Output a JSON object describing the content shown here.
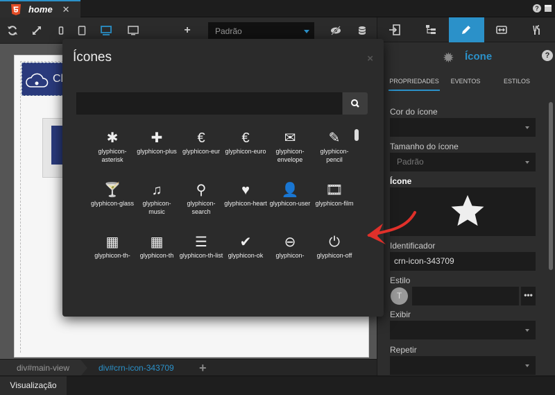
{
  "tabbar": {
    "tab_title": "home",
    "tab_close": "✕",
    "help": "?"
  },
  "toolbar": {
    "mode_select_value": "Padrão",
    "add_label": "+"
  },
  "canvas": {
    "logo_text": "Cl"
  },
  "breadcrumb": {
    "items": [
      "div#main-view",
      "div#crn-icon-343709"
    ],
    "add_label": "+"
  },
  "bottombar": {
    "tab_label": "Visualização"
  },
  "rightpanel": {
    "title": "Ícone",
    "help": "?",
    "subtabs": [
      "PROPRIEDADES",
      "EVENTOS",
      "ESTILOS"
    ],
    "fields": {
      "cor_label": "Cor do ícone",
      "cor_value": "",
      "tamanho_label": "Tamanho do ícone",
      "tamanho_value": "Padrão",
      "icone_label": "Ícone",
      "identificador_label": "Identificador",
      "identificador_value": "crn-icon-343709",
      "estilo_label": "Estilo",
      "estilo_avatar": "T",
      "estilo_more": "•••",
      "exibir_label": "Exibir",
      "repetir_label": "Repetir"
    }
  },
  "modal": {
    "title": "Ícones",
    "close": "×",
    "search_placeholder": "",
    "icons": [
      {
        "glyph": "✱",
        "label": "glyphicon-asterisk",
        "icon": "asterisk-icon"
      },
      {
        "glyph": "✚",
        "label": "glyphicon-plus",
        "icon": "plus-icon"
      },
      {
        "glyph": "€",
        "label": "glyphicon-eur",
        "icon": "eur-icon"
      },
      {
        "glyph": "€",
        "label": "glyphicon-euro",
        "icon": "euro-icon"
      },
      {
        "glyph": "✉",
        "label": "glyphicon-envelope",
        "icon": "envelope-icon"
      },
      {
        "glyph": "✎",
        "label": "glyphicon-pencil",
        "icon": "pencil-icon"
      },
      {
        "glyph": "🍸",
        "label": "glyphicon-glass",
        "icon": "glass-icon"
      },
      {
        "glyph": "♫",
        "label": "glyphicon-music",
        "icon": "music-icon"
      },
      {
        "glyph": "⚲",
        "label": "glyphicon-search",
        "icon": "search-icon"
      },
      {
        "glyph": "♥",
        "label": "glyphicon-heart",
        "icon": "heart-icon"
      },
      {
        "glyph": "👤",
        "label": "glyphicon-user",
        "icon": "user-icon"
      },
      {
        "glyph": "🎞",
        "label": "glyphicon-film",
        "icon": "film-icon"
      },
      {
        "glyph": "▦",
        "label": "glyphicon-th-large",
        "icon": "th-large-icon"
      },
      {
        "glyph": "▦",
        "label": "glyphicon-th",
        "icon": "th-icon"
      },
      {
        "glyph": "☰",
        "label": "glyphicon-th-list",
        "icon": "th-list-icon"
      },
      {
        "glyph": "✔",
        "label": "glyphicon-ok",
        "icon": "ok-icon"
      },
      {
        "glyph": "⊖",
        "label": "glyphicon-zoom-out",
        "icon": "zoom-out-icon"
      },
      {
        "glyph": "⏻",
        "label": "glyphicon-off",
        "icon": "off-icon"
      }
    ]
  },
  "colors": {
    "accent": "#2b91c9",
    "panel": "#2d2d2d",
    "input": "#1c1c1c",
    "annotation_arrow": "#e0302a"
  }
}
